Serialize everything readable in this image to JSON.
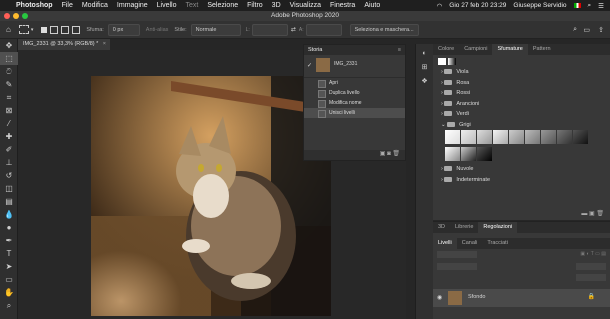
{
  "menubar": {
    "app": "Photoshop",
    "items": [
      "File",
      "Modifica",
      "Immagine",
      "Livello",
      "Text",
      "Selezione",
      "Filtro",
      "3D",
      "Visualizza",
      "Finestra",
      "Aiuto"
    ],
    "datetime": "Gio 27 feb 20 23:29",
    "user": "Giuseppe Servidio"
  },
  "window": {
    "title": "Adobe Photoshop 2020"
  },
  "options": {
    "sfuma_label": "Sfuma:",
    "sfuma_value": "0 px",
    "antialias_label": "Anti-alias",
    "stile_label": "Stile:",
    "stile_value": "Normale",
    "selmask_label": "Seleziona e maschera..."
  },
  "document": {
    "tab_title": "IMG_2331 @ 33,3% (RGB/8) *"
  },
  "history": {
    "title": "Storia",
    "snapshot": "IMG_2331",
    "items": [
      "Apri",
      "Duplica livello",
      "Modifica nome",
      "Unisci livelli"
    ]
  },
  "swatches": {
    "tabs": [
      "Colore",
      "Campioni",
      "Sfumature",
      "Pattern"
    ],
    "active_tab": "Sfumature",
    "folders": [
      "Viola",
      "Rosa",
      "Rossi",
      "Arancioni",
      "Verdi",
      "Grigi",
      "Nuvole",
      "Indeterminate"
    ]
  },
  "layers_panel": {
    "top_tabs": [
      "3D",
      "Librerie",
      "Regolazioni"
    ],
    "tabs": [
      "Livelli",
      "Canali",
      "Tracciati"
    ],
    "layer_name": "Sfondo"
  },
  "colors": {
    "accent": "#1473e6"
  }
}
